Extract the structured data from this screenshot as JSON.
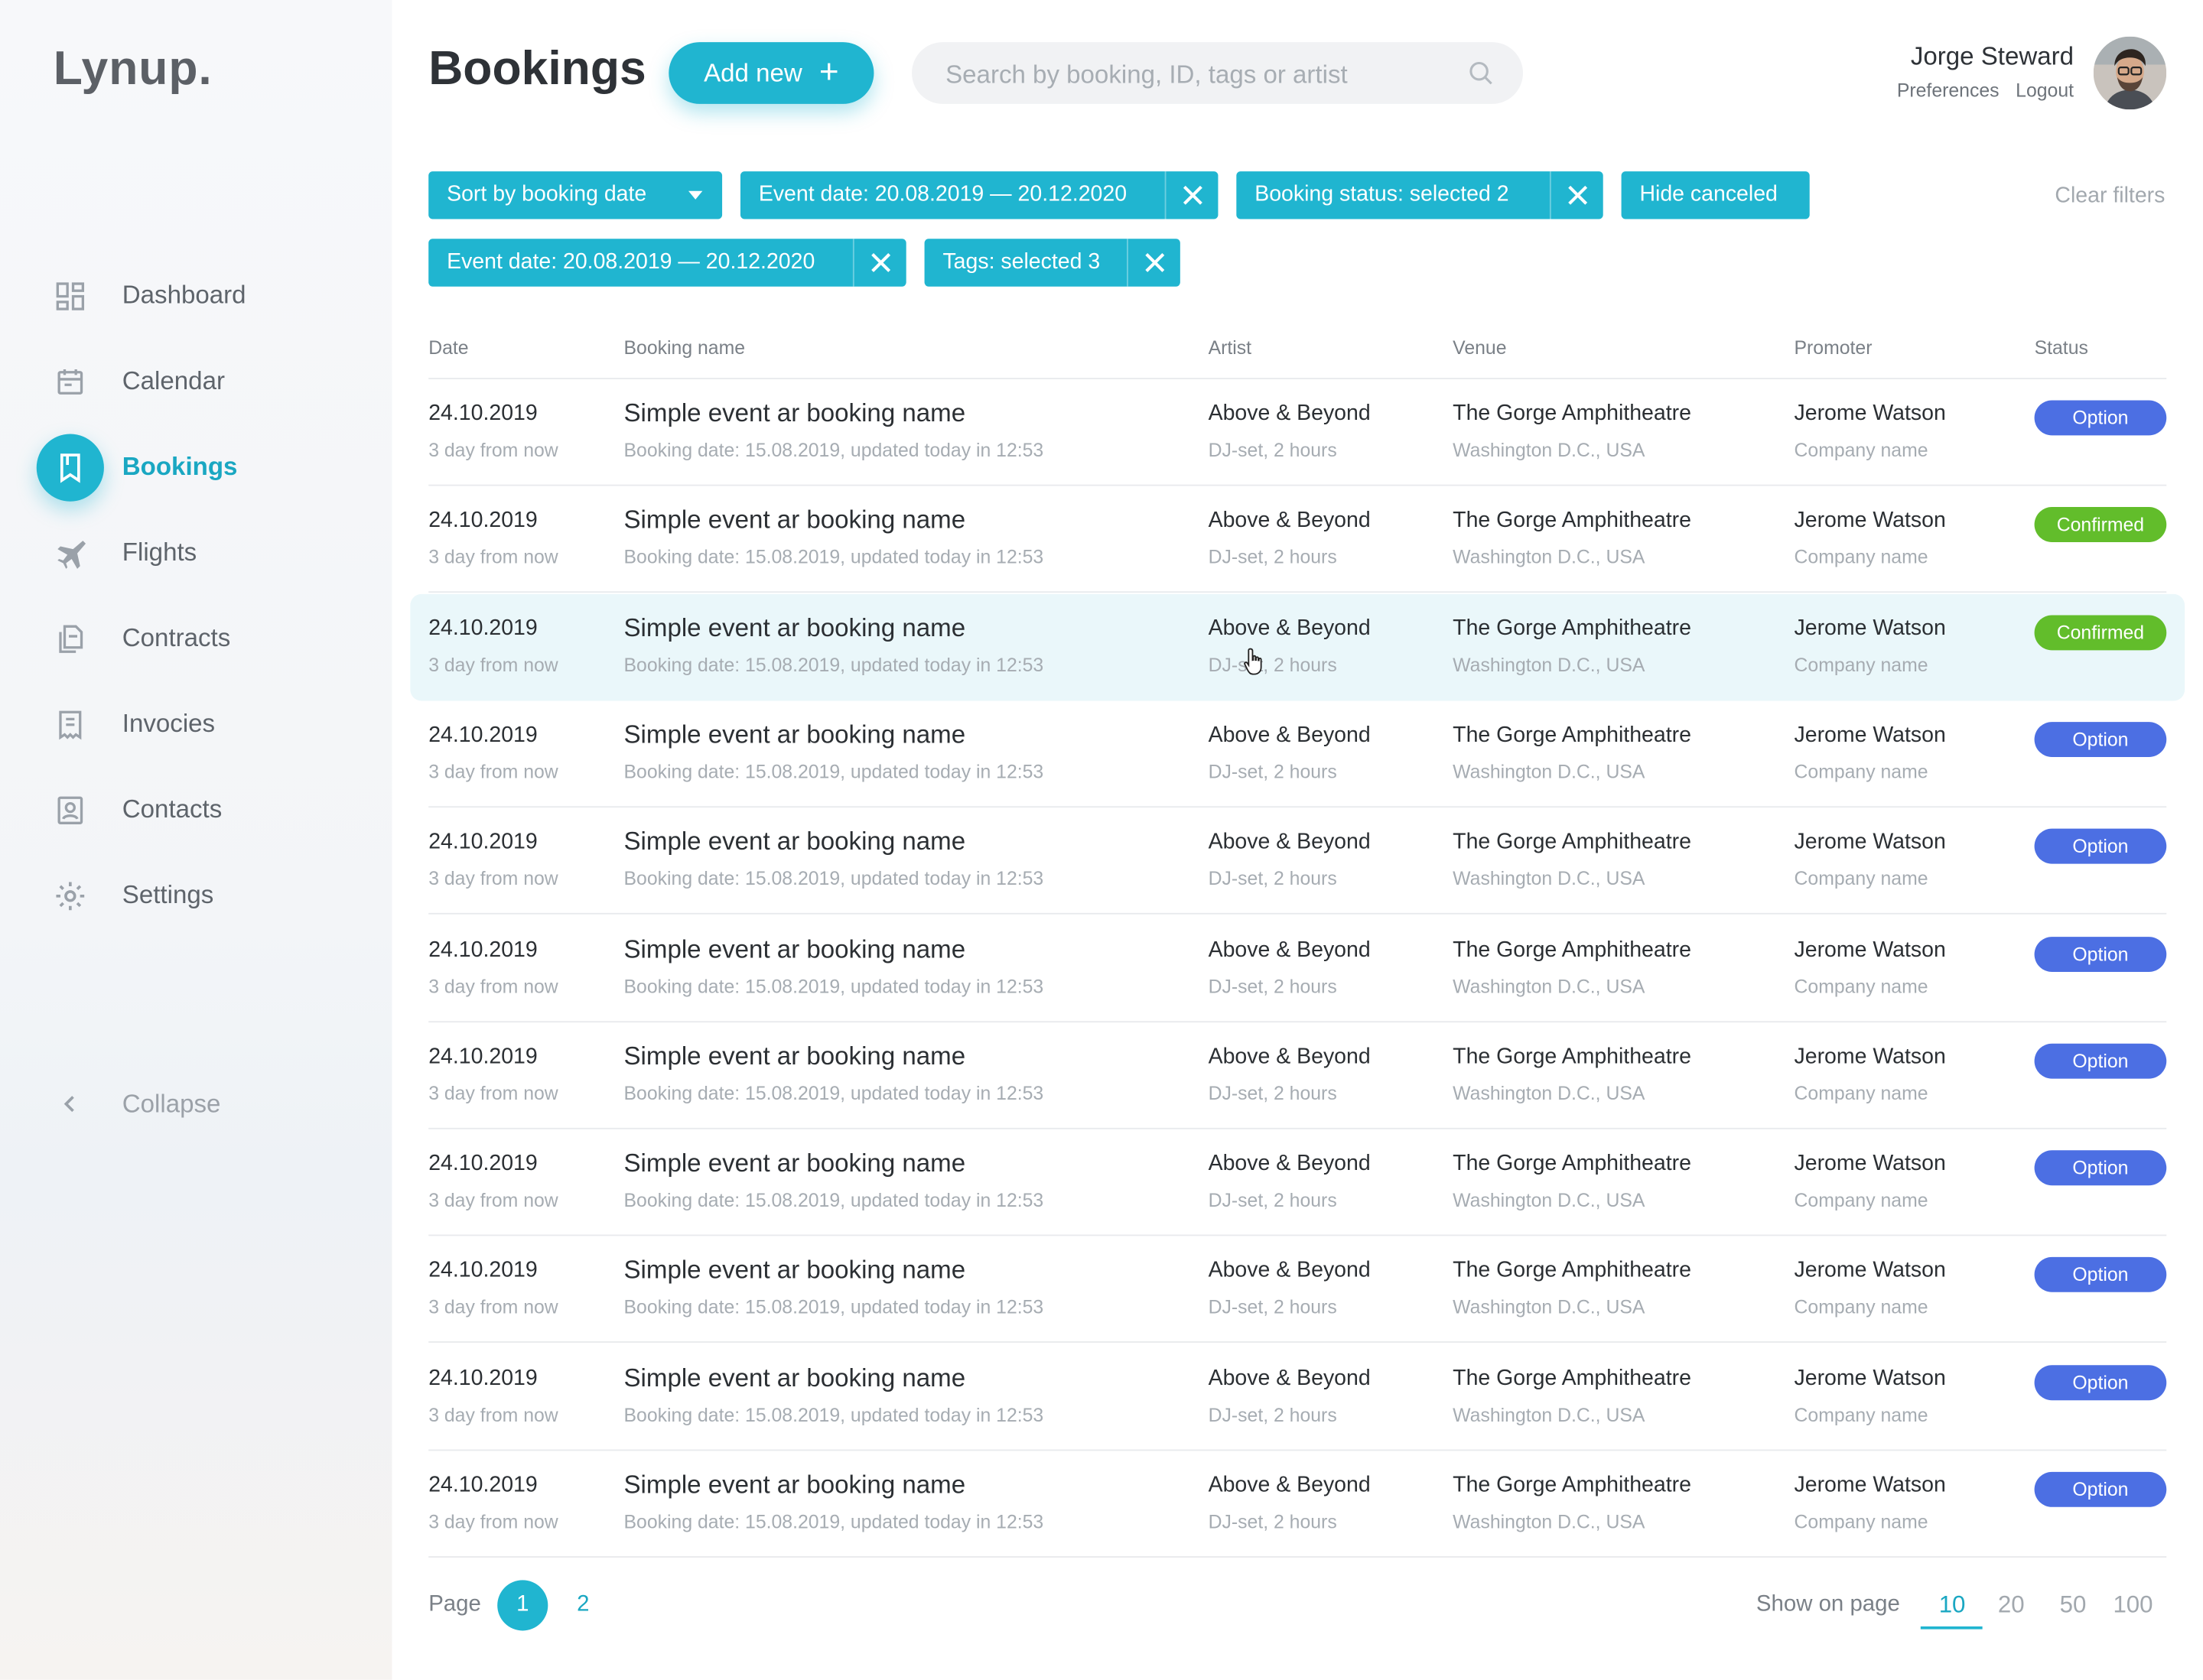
{
  "app": {
    "logo": "Lynup."
  },
  "sidebar": {
    "items": [
      {
        "label": "Dashboard",
        "icon": "dashboard-icon"
      },
      {
        "label": "Calendar",
        "icon": "calendar-icon"
      },
      {
        "label": "Bookings",
        "icon": "bookmark-icon",
        "active": true
      },
      {
        "label": "Flights",
        "icon": "airplane-icon"
      },
      {
        "label": "Contracts",
        "icon": "documents-icon"
      },
      {
        "label": "Invocies",
        "icon": "invoice-icon"
      },
      {
        "label": "Contacts",
        "icon": "contact-card-icon"
      },
      {
        "label": "Settings",
        "icon": "gear-icon"
      }
    ],
    "collapse_label": "Collapse"
  },
  "header": {
    "title": "Bookings",
    "add_button": "Add new",
    "search_placeholder": "Search by booking, ID, tags or artist",
    "user": {
      "name": "Jorge Steward",
      "preferences": "Preferences",
      "logout": "Logout"
    }
  },
  "filters": {
    "chips": [
      {
        "text": "Sort by booking date"
      },
      {
        "text": "Event date: 20.08.2019 — 20.12.2020"
      },
      {
        "text": "Booking status: selected 2"
      },
      {
        "text": "Hide canceled"
      },
      {
        "text": "Event date: 20.08.2019 — 20.12.2020"
      },
      {
        "text": "Tags: selected 3"
      }
    ],
    "clear_label": "Clear filters"
  },
  "table": {
    "columns": [
      "Date",
      "Booking name",
      "Artist",
      "Venue",
      "Promoter",
      "Status"
    ],
    "rows": [
      {
        "date": "24.10.2019",
        "date_sub": "3 day from now",
        "name": "Simple event ar booking name",
        "name_sub": "Booking date: 15.08.2019, updated today in 12:53",
        "artist": "Above & Beyond",
        "artist_sub": "DJ-set, 2 hours",
        "venue": "The Gorge Amphitheatre",
        "venue_sub": "Washington D.C., USA",
        "promoter": "Jerome Watson",
        "promoter_sub": "Company name",
        "status": "Option"
      },
      {
        "date": "24.10.2019",
        "date_sub": "3 day from now",
        "name": "Simple event ar booking name",
        "name_sub": "Booking date: 15.08.2019, updated today in 12:53",
        "artist": "Above & Beyond",
        "artist_sub": "DJ-set, 2 hours",
        "venue": "The Gorge Amphitheatre",
        "venue_sub": "Washington D.C., USA",
        "promoter": "Jerome Watson",
        "promoter_sub": "Company name",
        "status": "Confirmed"
      },
      {
        "date": "24.10.2019",
        "date_sub": "3 day from now",
        "name": "Simple event ar booking name",
        "name_sub": "Booking date: 15.08.2019, updated today in 12:53",
        "artist": "Above & Beyond",
        "artist_sub": "DJ-set, 2 hours",
        "venue": "The Gorge Amphitheatre",
        "venue_sub": "Washington D.C., USA",
        "promoter": "Jerome Watson",
        "promoter_sub": "Company name",
        "status": "Confirmed",
        "hovered": true
      },
      {
        "date": "24.10.2019",
        "date_sub": "3 day from now",
        "name": "Simple event ar booking name",
        "name_sub": "Booking date: 15.08.2019, updated today in 12:53",
        "artist": "Above & Beyond",
        "artist_sub": "DJ-set, 2 hours",
        "venue": "The Gorge Amphitheatre",
        "venue_sub": "Washington D.C., USA",
        "promoter": "Jerome Watson",
        "promoter_sub": "Company name",
        "status": "Option"
      },
      {
        "date": "24.10.2019",
        "date_sub": "3 day from now",
        "name": "Simple event ar booking name",
        "name_sub": "Booking date: 15.08.2019, updated today in 12:53",
        "artist": "Above & Beyond",
        "artist_sub": "DJ-set, 2 hours",
        "venue": "The Gorge Amphitheatre",
        "venue_sub": "Washington D.C., USA",
        "promoter": "Jerome Watson",
        "promoter_sub": "Company name",
        "status": "Option"
      },
      {
        "date": "24.10.2019",
        "date_sub": "3 day from now",
        "name": "Simple event ar booking name",
        "name_sub": "Booking date: 15.08.2019, updated today in 12:53",
        "artist": "Above & Beyond",
        "artist_sub": "DJ-set, 2 hours",
        "venue": "The Gorge Amphitheatre",
        "venue_sub": "Washington D.C., USA",
        "promoter": "Jerome Watson",
        "promoter_sub": "Company name",
        "status": "Option"
      },
      {
        "date": "24.10.2019",
        "date_sub": "3 day from now",
        "name": "Simple event ar booking name",
        "name_sub": "Booking date: 15.08.2019, updated today in 12:53",
        "artist": "Above & Beyond",
        "artist_sub": "DJ-set, 2 hours",
        "venue": "The Gorge Amphitheatre",
        "venue_sub": "Washington D.C., USA",
        "promoter": "Jerome Watson",
        "promoter_sub": "Company name",
        "status": "Option"
      },
      {
        "date": "24.10.2019",
        "date_sub": "3 day from now",
        "name": "Simple event ar booking name",
        "name_sub": "Booking date: 15.08.2019, updated today in 12:53",
        "artist": "Above & Beyond",
        "artist_sub": "DJ-set, 2 hours",
        "venue": "The Gorge Amphitheatre",
        "venue_sub": "Washington D.C., USA",
        "promoter": "Jerome Watson",
        "promoter_sub": "Company name",
        "status": "Option"
      },
      {
        "date": "24.10.2019",
        "date_sub": "3 day from now",
        "name": "Simple event ar booking name",
        "name_sub": "Booking date: 15.08.2019, updated today in 12:53",
        "artist": "Above & Beyond",
        "artist_sub": "DJ-set, 2 hours",
        "venue": "The Gorge Amphitheatre",
        "venue_sub": "Washington D.C., USA",
        "promoter": "Jerome Watson",
        "promoter_sub": "Company name",
        "status": "Option"
      },
      {
        "date": "24.10.2019",
        "date_sub": "3 day from now",
        "name": "Simple event ar booking name",
        "name_sub": "Booking date: 15.08.2019, updated today in 12:53",
        "artist": "Above & Beyond",
        "artist_sub": "DJ-set, 2 hours",
        "venue": "The Gorge Amphitheatre",
        "venue_sub": "Washington D.C., USA",
        "promoter": "Jerome Watson",
        "promoter_sub": "Company name",
        "status": "Option"
      },
      {
        "date": "24.10.2019",
        "date_sub": "3 day from now",
        "name": "Simple event ar booking name",
        "name_sub": "Booking date: 15.08.2019, updated today in 12:53",
        "artist": "Above & Beyond",
        "artist_sub": "DJ-set, 2 hours",
        "venue": "The Gorge Amphitheatre",
        "venue_sub": "Washington D.C., USA",
        "promoter": "Jerome Watson",
        "promoter_sub": "Company name",
        "status": "Option"
      }
    ]
  },
  "pagination": {
    "label": "Page",
    "pages": [
      "1",
      "2"
    ],
    "current_page": "1",
    "show_label": "Show on page",
    "sizes": [
      "10",
      "20",
      "50",
      "100"
    ],
    "current_size": "10"
  },
  "colors": {
    "accent": "#20b5d0",
    "option": "#4c6fe3",
    "confirmed": "#62bd2b"
  }
}
